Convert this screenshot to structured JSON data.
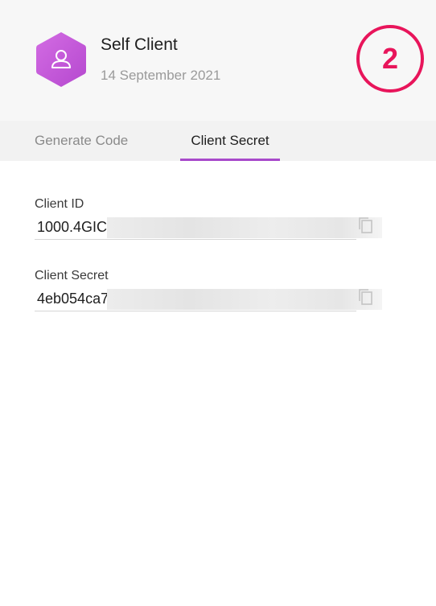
{
  "client": {
    "name": "Self Client",
    "date": "14 September 2021",
    "avatar_icon": "user-icon",
    "avatar_color": "#c558d9"
  },
  "step": {
    "number": "2",
    "color": "#e8155b"
  },
  "tabs": {
    "items": [
      {
        "label": "Generate Code",
        "active": false
      },
      {
        "label": "Client Secret",
        "active": true
      }
    ],
    "accent": "#a84acb"
  },
  "fields": {
    "client_id": {
      "label": "Client ID",
      "visible_value": "1000.4GIC",
      "icon": "copy-icon"
    },
    "client_secret": {
      "label": "Client Secret",
      "visible_value": "4eb054ca7",
      "icon": "copy-icon"
    }
  }
}
